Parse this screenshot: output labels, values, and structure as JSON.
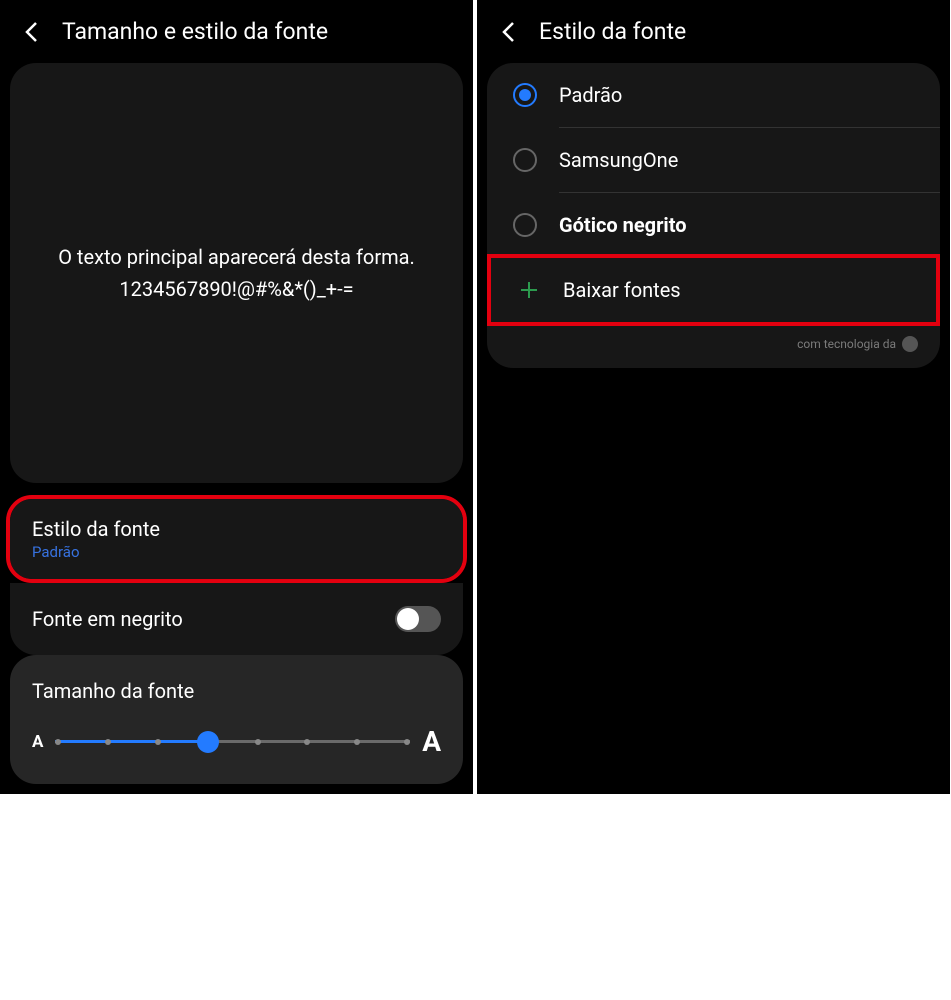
{
  "left": {
    "header_title": "Tamanho e estilo da fonte",
    "preview_line1": "O texto principal aparecerá desta forma.",
    "preview_line2": "1234567890!@#%&*()_+-=",
    "font_style": {
      "label": "Estilo da fonte",
      "value": "Padrão"
    },
    "bold_font": {
      "label": "Fonte em negrito",
      "enabled": false
    },
    "font_size": {
      "label": "Tamanho da fonte",
      "min_glyph": "A",
      "max_glyph": "A",
      "ticks": 8,
      "position_percent": 43
    }
  },
  "right": {
    "header_title": "Estilo da fonte",
    "options": [
      {
        "label": "Padrão",
        "selected": true,
        "bold": false
      },
      {
        "label": "SamsungOne",
        "selected": false,
        "bold": false
      },
      {
        "label": "Gótico negrito",
        "selected": false,
        "bold": true
      }
    ],
    "download_label": "Baixar fontes",
    "footer_text": "com tecnologia da"
  },
  "colors": {
    "accent": "#237bff",
    "highlight": "#e3000f",
    "download_plus": "#2c9b4e"
  }
}
